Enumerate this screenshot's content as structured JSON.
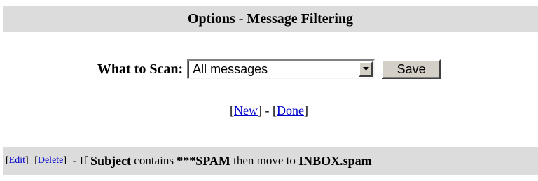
{
  "header": {
    "title": "Options - Message Filtering"
  },
  "scan": {
    "label": "What to Scan:",
    "selected_value": "All messages",
    "dropdown_icon": "chevron-down-icon",
    "save_label": "Save"
  },
  "actions": {
    "open_bracket_1": "[",
    "new_label": "New",
    "separator": "] - [",
    "done_label": "Done",
    "close_bracket_2": "]"
  },
  "rule": {
    "edit_label": "Edit",
    "delete_label": "Delete",
    "text_prefix": "- If",
    "field": "Subject",
    "text_contains": "contains",
    "pattern": "***SPAM",
    "text_then": "then move to",
    "target_folder": "INBOX.spam"
  },
  "colors": {
    "header_bg": "#dcdcdc",
    "rule_bg": "#dcdcdc",
    "link": "#0000cc",
    "button_face": "#d4d0c8"
  }
}
